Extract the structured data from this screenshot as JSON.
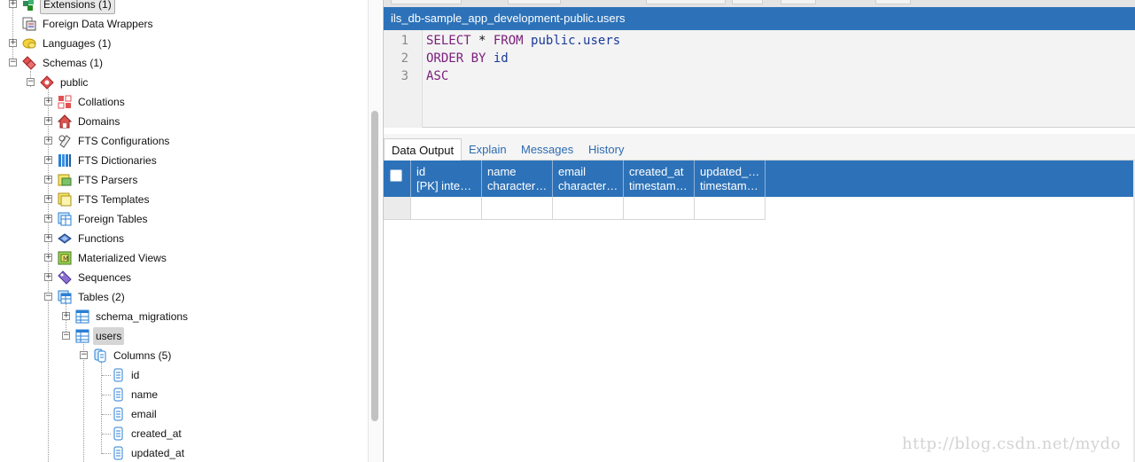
{
  "tree": {
    "items": [
      {
        "label": "Extensions (1)",
        "icon": "extensions-icon"
      },
      {
        "label": "Foreign Data Wrappers",
        "icon": "foreign-data-wrappers-icon"
      },
      {
        "label": "Languages (1)",
        "icon": "languages-icon"
      },
      {
        "label": "Schemas (1)",
        "icon": "schemas-icon"
      },
      {
        "label": "public",
        "icon": "schema-icon"
      },
      {
        "label": "Collations",
        "icon": "collations-icon"
      },
      {
        "label": "Domains",
        "icon": "domains-icon"
      },
      {
        "label": "FTS Configurations",
        "icon": "fts-configurations-icon"
      },
      {
        "label": "FTS Dictionaries",
        "icon": "fts-dictionaries-icon"
      },
      {
        "label": "FTS Parsers",
        "icon": "fts-parsers-icon"
      },
      {
        "label": "FTS Templates",
        "icon": "fts-templates-icon"
      },
      {
        "label": "Foreign Tables",
        "icon": "foreign-tables-icon"
      },
      {
        "label": "Functions",
        "icon": "functions-icon"
      },
      {
        "label": "Materialized Views",
        "icon": "materialized-views-icon"
      },
      {
        "label": "Sequences",
        "icon": "sequences-icon"
      },
      {
        "label": "Tables (2)",
        "icon": "tables-icon"
      },
      {
        "label": "schema_migrations",
        "icon": "table-icon"
      },
      {
        "label": "users",
        "icon": "table-icon"
      },
      {
        "label": "Columns (5)",
        "icon": "columns-icon"
      },
      {
        "label": "id",
        "icon": "column-icon"
      },
      {
        "label": "name",
        "icon": "column-icon"
      },
      {
        "label": "email",
        "icon": "column-icon"
      },
      {
        "label": "created_at",
        "icon": "column-icon"
      },
      {
        "label": "updated_at",
        "icon": "column-icon"
      }
    ]
  },
  "query": {
    "title": "ils_db-sample_app_development-public.users",
    "lines": [
      {
        "num": "1",
        "parts": [
          {
            "t": "SELECT ",
            "c": "kw"
          },
          {
            "t": "* ",
            "c": "op"
          },
          {
            "t": "FROM ",
            "c": "kw"
          },
          {
            "t": "public.users",
            "c": "id"
          }
        ]
      },
      {
        "num": "2",
        "parts": [
          {
            "t": "ORDER BY ",
            "c": "kw"
          },
          {
            "t": "id",
            "c": "id"
          }
        ]
      },
      {
        "num": "3",
        "parts": [
          {
            "t": "ASC",
            "c": "kw"
          }
        ]
      }
    ]
  },
  "output_tabs": [
    "Data Output",
    "Explain",
    "Messages",
    "History"
  ],
  "grid": {
    "columns": [
      {
        "line1": "id",
        "line2": "[PK] inte…"
      },
      {
        "line1": "name",
        "line2": "character…"
      },
      {
        "line1": "email",
        "line2": "character…"
      },
      {
        "line1": "created_at",
        "line2": "timestam…"
      },
      {
        "line1": "updated_…",
        "line2": "timestam…"
      }
    ]
  },
  "watermark": "http://blog.csdn.net/mydo",
  "colors": {
    "accent": "#2d72b8",
    "tab_link": "#2d6bb0"
  }
}
